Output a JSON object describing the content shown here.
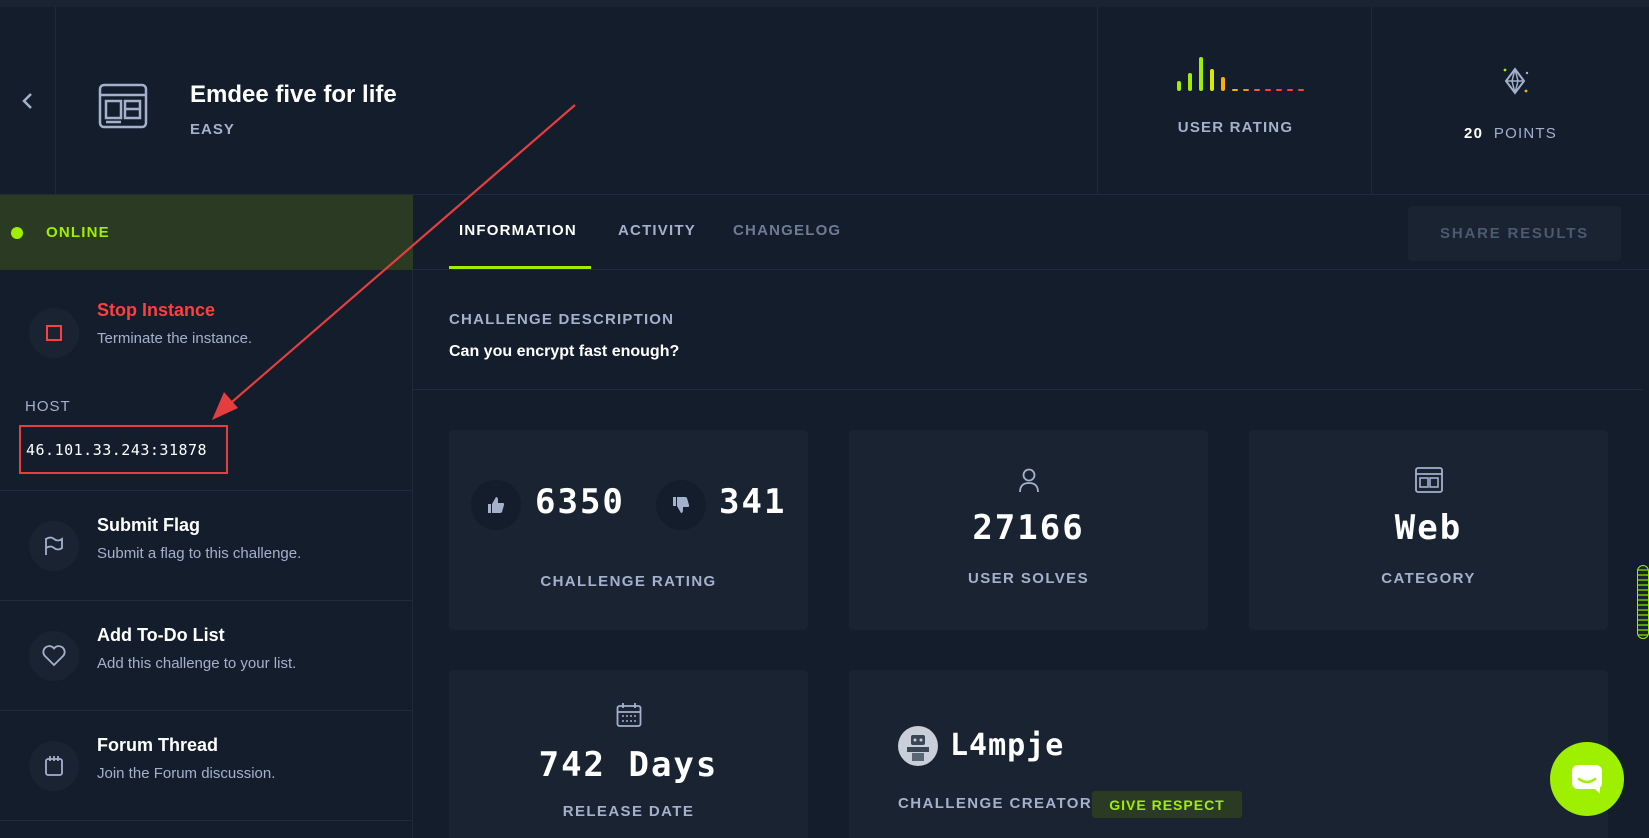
{
  "header": {
    "title": "Emdee five for life",
    "difficulty": "EASY",
    "user_rating_label": "USER RATING",
    "points_value": "20",
    "points_label": "POINTS",
    "rating_bar_colors": [
      "#9fef00",
      "#9fef00",
      "#9fef00",
      "#d9e900",
      "#ffaf00",
      "#ffaf00",
      "#ff8a1f",
      "#ff5a36",
      "#ff3e3e"
    ]
  },
  "sidebar": {
    "status": "ONLINE",
    "stop": {
      "title": "Stop Instance",
      "subtitle": "Terminate the instance."
    },
    "host_label": "HOST",
    "host_value": "46.101.33.243:31878",
    "items": [
      {
        "title": "Submit Flag",
        "subtitle": "Submit a flag to this challenge.",
        "icon": "flag-icon"
      },
      {
        "title": "Add To-Do List",
        "subtitle": "Add this challenge to your list.",
        "icon": "heart-icon"
      },
      {
        "title": "Forum Thread",
        "subtitle": "Join the Forum discussion.",
        "icon": "notepad-icon"
      }
    ]
  },
  "tabs": [
    "INFORMATION",
    "ACTIVITY",
    "CHANGELOG"
  ],
  "share_label": "SHARE RESULTS",
  "description": {
    "heading": "CHALLENGE DESCRIPTION",
    "text": "Can you encrypt fast enough?"
  },
  "stats": {
    "upvotes": "6350",
    "downvotes": "341",
    "rating_caption": "CHALLENGE RATING",
    "solves": "27166",
    "solves_caption": "USER SOLVES",
    "category": "Web",
    "category_caption": "CATEGORY",
    "release": "742 Days",
    "release_caption": "RELEASE DATE",
    "creator": "L4mpje",
    "creator_caption": "CHALLENGE CREATOR",
    "respect_label": "GIVE RESPECT"
  },
  "colors": {
    "accent": "#9fef00",
    "danger": "#ff3e3e",
    "bg": "#141d2b",
    "card": "#1a2332"
  }
}
